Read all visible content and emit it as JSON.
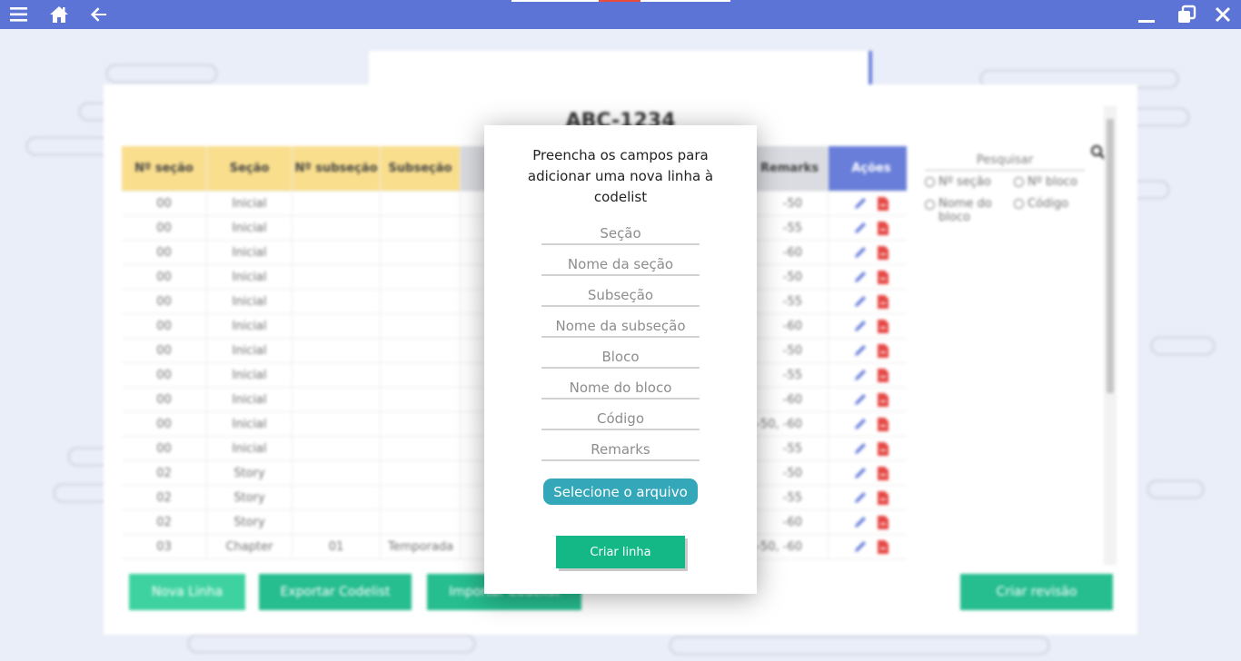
{
  "titlebar": {
    "icons": [
      "menu-icon",
      "home-icon",
      "back-arrow-icon",
      "minimize-icon",
      "restore-icon",
      "close-icon"
    ],
    "color": "#5c74d6"
  },
  "card": {
    "title": "ABC-1234"
  },
  "table": {
    "headers": [
      "Nº seção",
      "Seção",
      "Nº subseção",
      "Subseção",
      "Remarks",
      "Ações"
    ],
    "rows": [
      {
        "secao_num": "00",
        "secao": "Inicial",
        "sub_num": "",
        "subsecao": "",
        "remarks": "-50"
      },
      {
        "secao_num": "00",
        "secao": "Inicial",
        "sub_num": "",
        "subsecao": "",
        "remarks": "-55"
      },
      {
        "secao_num": "00",
        "secao": "Inicial",
        "sub_num": "",
        "subsecao": "",
        "remarks": "-60"
      },
      {
        "secao_num": "00",
        "secao": "Inicial",
        "sub_num": "",
        "subsecao": "",
        "remarks": "-50"
      },
      {
        "secao_num": "00",
        "secao": "Inicial",
        "sub_num": "",
        "subsecao": "",
        "remarks": "-55"
      },
      {
        "secao_num": "00",
        "secao": "Inicial",
        "sub_num": "",
        "subsecao": "",
        "remarks": "-60"
      },
      {
        "secao_num": "00",
        "secao": "Inicial",
        "sub_num": "",
        "subsecao": "",
        "remarks": "-50"
      },
      {
        "secao_num": "00",
        "secao": "Inicial",
        "sub_num": "",
        "subsecao": "",
        "remarks": "-55"
      },
      {
        "secao_num": "00",
        "secao": "Inicial",
        "sub_num": "",
        "subsecao": "",
        "remarks": "-60"
      },
      {
        "secao_num": "00",
        "secao": "Inicial",
        "sub_num": "",
        "subsecao": "",
        "remarks": "-50, -60"
      },
      {
        "secao_num": "00",
        "secao": "Inicial",
        "sub_num": "",
        "subsecao": "",
        "remarks": "-55"
      },
      {
        "secao_num": "02",
        "secao": "Story",
        "sub_num": "",
        "subsecao": "",
        "remarks": "-50"
      },
      {
        "secao_num": "02",
        "secao": "Story",
        "sub_num": "",
        "subsecao": "",
        "remarks": "-55"
      },
      {
        "secao_num": "02",
        "secao": "Story",
        "sub_num": "",
        "subsecao": "",
        "remarks": "-60"
      },
      {
        "secao_num": "03",
        "secao": "Chapter",
        "sub_num": "01",
        "subsecao": "Temporada",
        "remarks": "-50, -60"
      }
    ]
  },
  "sidebar": {
    "search_placeholder": "Pesquisar",
    "filters": [
      "Nº seção",
      "Nº bloco",
      "Nome do bloco",
      "Código"
    ]
  },
  "bottom_buttons": {
    "nova_linha": "Nova Linha",
    "exportar": "Exportar Codelist",
    "importar": "Importar Codelist",
    "criar_revisao": "Criar revisão"
  },
  "modal": {
    "title": "Preencha os campos para adicionar uma nova linha à codelist",
    "fields": [
      {
        "placeholder": "Seção",
        "value": ""
      },
      {
        "placeholder": "Nome da seção",
        "value": ""
      },
      {
        "placeholder": "Subseção",
        "value": ""
      },
      {
        "placeholder": "Nome da subseção",
        "value": ""
      },
      {
        "placeholder": "Bloco",
        "value": ""
      },
      {
        "placeholder": "Nome do bloco",
        "value": ""
      },
      {
        "placeholder": "Código",
        "value": ""
      },
      {
        "placeholder": "Remarks",
        "value": ""
      }
    ],
    "file_button": "Selecione o arquivo",
    "submit_button": "Criar linha"
  },
  "colors": {
    "accent": "#5c74d6",
    "header_yellow": "#f9dc84",
    "green": "#14b886",
    "teal": "#34a8b8",
    "delete_red": "#e53935"
  }
}
